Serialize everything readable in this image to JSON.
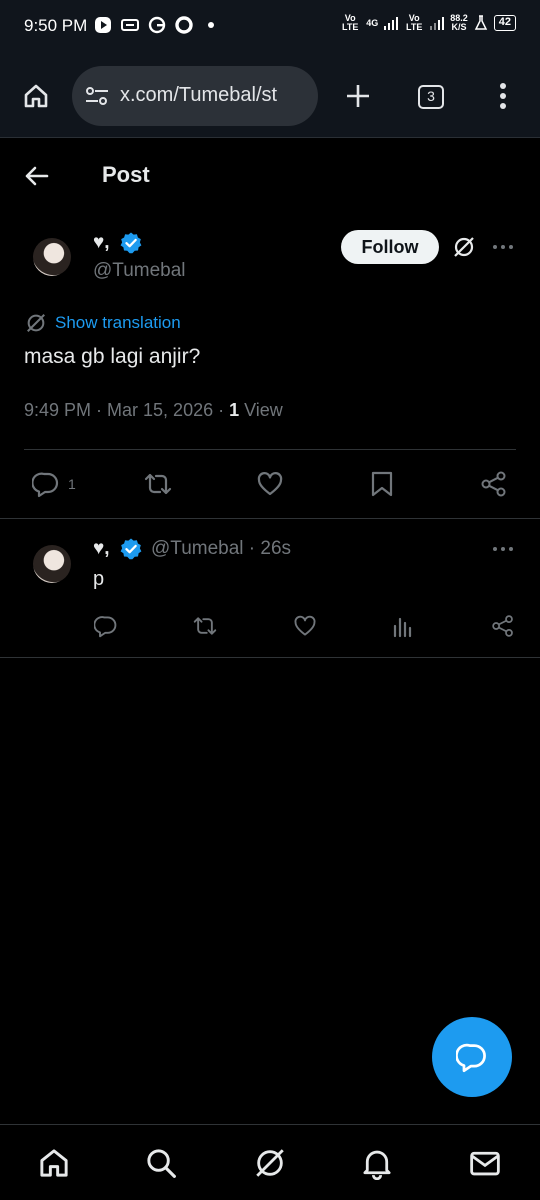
{
  "status_bar": {
    "time": "9:50 PM",
    "network_speed": "88.2",
    "network_speed_unit": "K/S",
    "battery": "42",
    "volte1": "Vo LTE",
    "net_type": "4G",
    "volte2": "Vo LTE"
  },
  "browser": {
    "url": "x.com/Tumebal/st",
    "tab_count": "3"
  },
  "header": {
    "title": "Post"
  },
  "post": {
    "display_name": "♥,",
    "handle": "@Tumebal",
    "follow_label": "Follow",
    "show_translation": "Show translation",
    "text": "masa gb lagi anjir?",
    "timestamp": "9:49 PM · Mar 15, 2026 · ",
    "views_count": "1",
    "views_label": " View",
    "reply_count": "1"
  },
  "reply": {
    "display_name": "♥,",
    "handle_time": "@Tumebal · 26s",
    "text": "p"
  },
  "colors": {
    "accent": "#1d9bf0",
    "background": "#000000",
    "secondary_text": "#71767b"
  }
}
